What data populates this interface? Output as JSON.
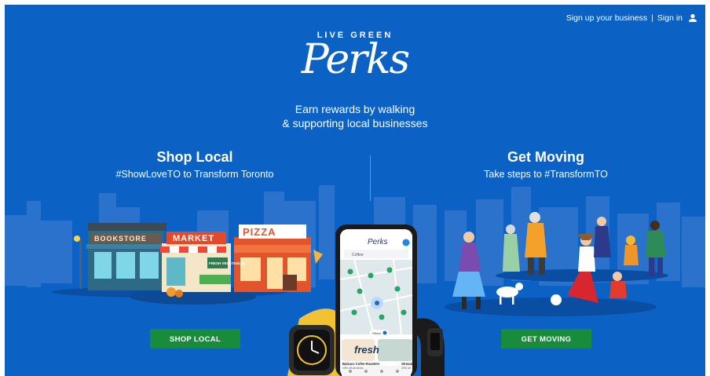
{
  "nav": {
    "signup": "Sign up your business",
    "separator": "|",
    "signin": "Sign in",
    "user_icon": "user-icon"
  },
  "brand": {
    "top": "LIVE GREEN",
    "script": "Perks"
  },
  "tagline": {
    "line1": "Earn rewards by walking",
    "line2": "& supporting local businesses"
  },
  "shop": {
    "title": "Shop Local",
    "subtitle": "#ShowLoveTO to Transform Toronto",
    "button": "SHOP LOCAL",
    "stores": [
      "BOOKSTORE",
      "MARKET",
      "PIZZA"
    ],
    "store_sign": "FRESH VEGETABLES"
  },
  "moving": {
    "title": "Get Moving",
    "subtitle": "Take steps to #TransformTO",
    "button": "GET MOVING"
  },
  "phone": {
    "app_title": "Perks",
    "search": "Coffee",
    "chip": "Filters",
    "card_brand": "fresh",
    "card1_title": "Balzacs Cofee Roasters",
    "card1_sub": "15% off all drinks",
    "card2_title": "Stream",
    "card2_sub": "20% off"
  },
  "colors": {
    "background": "#0b62c4",
    "button": "#198c3c"
  }
}
